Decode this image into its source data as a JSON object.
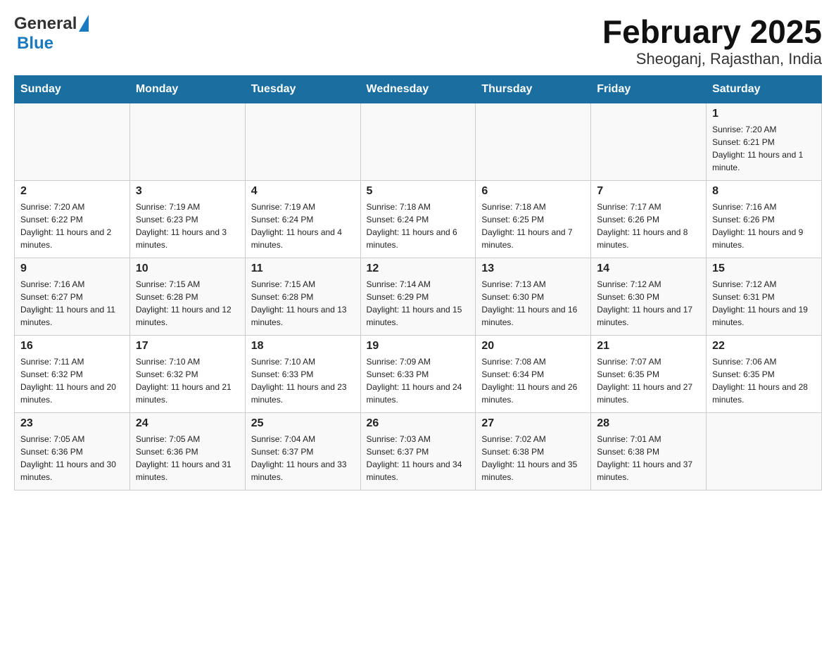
{
  "header": {
    "logo_general": "General",
    "logo_blue": "Blue",
    "title": "February 2025",
    "subtitle": "Sheoganj, Rajasthan, India"
  },
  "days_of_week": [
    "Sunday",
    "Monday",
    "Tuesday",
    "Wednesday",
    "Thursday",
    "Friday",
    "Saturday"
  ],
  "weeks": [
    [
      {
        "day": "",
        "sunrise": "",
        "sunset": "",
        "daylight": ""
      },
      {
        "day": "",
        "sunrise": "",
        "sunset": "",
        "daylight": ""
      },
      {
        "day": "",
        "sunrise": "",
        "sunset": "",
        "daylight": ""
      },
      {
        "day": "",
        "sunrise": "",
        "sunset": "",
        "daylight": ""
      },
      {
        "day": "",
        "sunrise": "",
        "sunset": "",
        "daylight": ""
      },
      {
        "day": "",
        "sunrise": "",
        "sunset": "",
        "daylight": ""
      },
      {
        "day": "1",
        "sunrise": "Sunrise: 7:20 AM",
        "sunset": "Sunset: 6:21 PM",
        "daylight": "Daylight: 11 hours and 1 minute."
      }
    ],
    [
      {
        "day": "2",
        "sunrise": "Sunrise: 7:20 AM",
        "sunset": "Sunset: 6:22 PM",
        "daylight": "Daylight: 11 hours and 2 minutes."
      },
      {
        "day": "3",
        "sunrise": "Sunrise: 7:19 AM",
        "sunset": "Sunset: 6:23 PM",
        "daylight": "Daylight: 11 hours and 3 minutes."
      },
      {
        "day": "4",
        "sunrise": "Sunrise: 7:19 AM",
        "sunset": "Sunset: 6:24 PM",
        "daylight": "Daylight: 11 hours and 4 minutes."
      },
      {
        "day": "5",
        "sunrise": "Sunrise: 7:18 AM",
        "sunset": "Sunset: 6:24 PM",
        "daylight": "Daylight: 11 hours and 6 minutes."
      },
      {
        "day": "6",
        "sunrise": "Sunrise: 7:18 AM",
        "sunset": "Sunset: 6:25 PM",
        "daylight": "Daylight: 11 hours and 7 minutes."
      },
      {
        "day": "7",
        "sunrise": "Sunrise: 7:17 AM",
        "sunset": "Sunset: 6:26 PM",
        "daylight": "Daylight: 11 hours and 8 minutes."
      },
      {
        "day": "8",
        "sunrise": "Sunrise: 7:16 AM",
        "sunset": "Sunset: 6:26 PM",
        "daylight": "Daylight: 11 hours and 9 minutes."
      }
    ],
    [
      {
        "day": "9",
        "sunrise": "Sunrise: 7:16 AM",
        "sunset": "Sunset: 6:27 PM",
        "daylight": "Daylight: 11 hours and 11 minutes."
      },
      {
        "day": "10",
        "sunrise": "Sunrise: 7:15 AM",
        "sunset": "Sunset: 6:28 PM",
        "daylight": "Daylight: 11 hours and 12 minutes."
      },
      {
        "day": "11",
        "sunrise": "Sunrise: 7:15 AM",
        "sunset": "Sunset: 6:28 PM",
        "daylight": "Daylight: 11 hours and 13 minutes."
      },
      {
        "day": "12",
        "sunrise": "Sunrise: 7:14 AM",
        "sunset": "Sunset: 6:29 PM",
        "daylight": "Daylight: 11 hours and 15 minutes."
      },
      {
        "day": "13",
        "sunrise": "Sunrise: 7:13 AM",
        "sunset": "Sunset: 6:30 PM",
        "daylight": "Daylight: 11 hours and 16 minutes."
      },
      {
        "day": "14",
        "sunrise": "Sunrise: 7:12 AM",
        "sunset": "Sunset: 6:30 PM",
        "daylight": "Daylight: 11 hours and 17 minutes."
      },
      {
        "day": "15",
        "sunrise": "Sunrise: 7:12 AM",
        "sunset": "Sunset: 6:31 PM",
        "daylight": "Daylight: 11 hours and 19 minutes."
      }
    ],
    [
      {
        "day": "16",
        "sunrise": "Sunrise: 7:11 AM",
        "sunset": "Sunset: 6:32 PM",
        "daylight": "Daylight: 11 hours and 20 minutes."
      },
      {
        "day": "17",
        "sunrise": "Sunrise: 7:10 AM",
        "sunset": "Sunset: 6:32 PM",
        "daylight": "Daylight: 11 hours and 21 minutes."
      },
      {
        "day": "18",
        "sunrise": "Sunrise: 7:10 AM",
        "sunset": "Sunset: 6:33 PM",
        "daylight": "Daylight: 11 hours and 23 minutes."
      },
      {
        "day": "19",
        "sunrise": "Sunrise: 7:09 AM",
        "sunset": "Sunset: 6:33 PM",
        "daylight": "Daylight: 11 hours and 24 minutes."
      },
      {
        "day": "20",
        "sunrise": "Sunrise: 7:08 AM",
        "sunset": "Sunset: 6:34 PM",
        "daylight": "Daylight: 11 hours and 26 minutes."
      },
      {
        "day": "21",
        "sunrise": "Sunrise: 7:07 AM",
        "sunset": "Sunset: 6:35 PM",
        "daylight": "Daylight: 11 hours and 27 minutes."
      },
      {
        "day": "22",
        "sunrise": "Sunrise: 7:06 AM",
        "sunset": "Sunset: 6:35 PM",
        "daylight": "Daylight: 11 hours and 28 minutes."
      }
    ],
    [
      {
        "day": "23",
        "sunrise": "Sunrise: 7:05 AM",
        "sunset": "Sunset: 6:36 PM",
        "daylight": "Daylight: 11 hours and 30 minutes."
      },
      {
        "day": "24",
        "sunrise": "Sunrise: 7:05 AM",
        "sunset": "Sunset: 6:36 PM",
        "daylight": "Daylight: 11 hours and 31 minutes."
      },
      {
        "day": "25",
        "sunrise": "Sunrise: 7:04 AM",
        "sunset": "Sunset: 6:37 PM",
        "daylight": "Daylight: 11 hours and 33 minutes."
      },
      {
        "day": "26",
        "sunrise": "Sunrise: 7:03 AM",
        "sunset": "Sunset: 6:37 PM",
        "daylight": "Daylight: 11 hours and 34 minutes."
      },
      {
        "day": "27",
        "sunrise": "Sunrise: 7:02 AM",
        "sunset": "Sunset: 6:38 PM",
        "daylight": "Daylight: 11 hours and 35 minutes."
      },
      {
        "day": "28",
        "sunrise": "Sunrise: 7:01 AM",
        "sunset": "Sunset: 6:38 PM",
        "daylight": "Daylight: 11 hours and 37 minutes."
      },
      {
        "day": "",
        "sunrise": "",
        "sunset": "",
        "daylight": ""
      }
    ]
  ]
}
